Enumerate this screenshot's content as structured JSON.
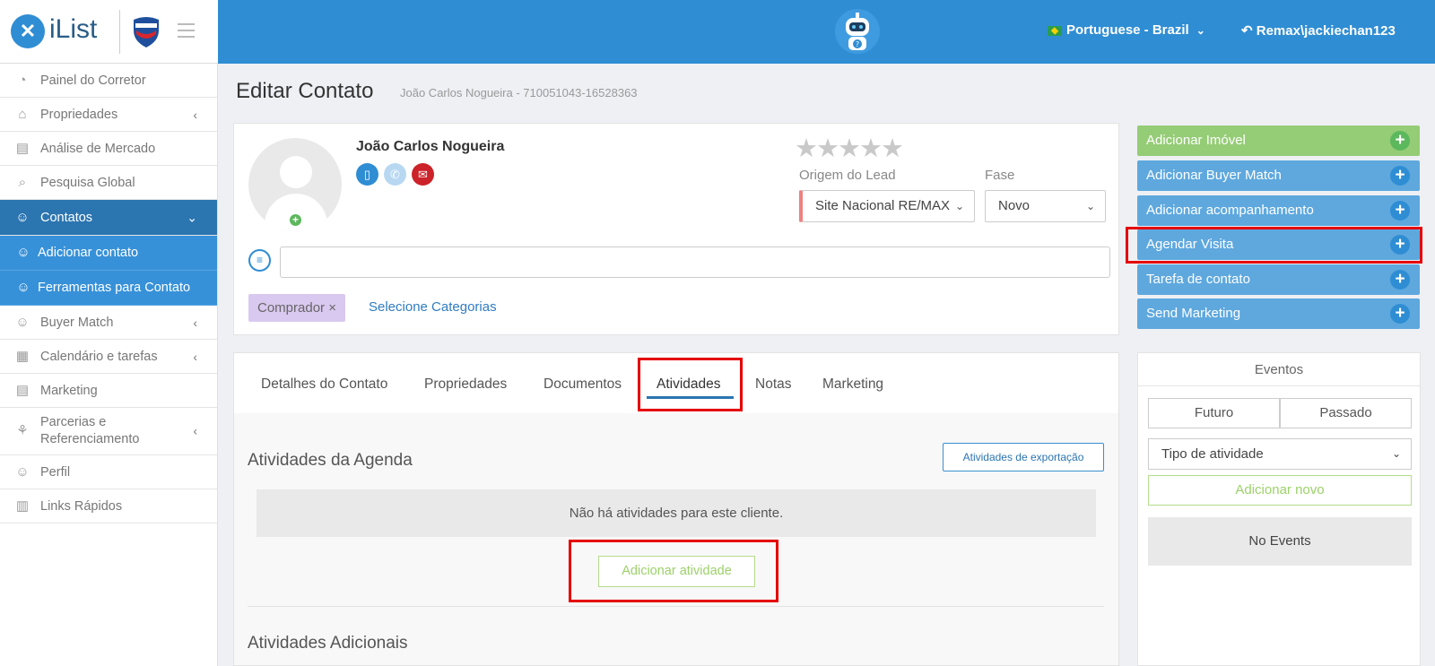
{
  "header": {
    "brand_name": "iList",
    "language": "Portuguese - Brazil",
    "user": "Remax\\jackiechan123"
  },
  "sidebar": {
    "items": [
      {
        "label": "Painel do Corretor",
        "icon": "gauge-icon"
      },
      {
        "label": "Propriedades",
        "icon": "home-icon"
      },
      {
        "label": "Análise de Mercado",
        "icon": "book-icon"
      },
      {
        "label": "Pesquisa Global",
        "icon": "search-icon"
      },
      {
        "label": "Contatos",
        "icon": "contacts-icon"
      },
      {
        "label": "Adicionar contato",
        "icon": "contacts-icon"
      },
      {
        "label": "Ferramentas para Contato",
        "icon": "contacts-icon"
      },
      {
        "label": "Buyer Match",
        "icon": "user-search-icon"
      },
      {
        "label": "Calendário e tarefas",
        "icon": "calendar-icon"
      },
      {
        "label": "Marketing",
        "icon": "book-icon"
      },
      {
        "label": "Parcerias e Referenciamento",
        "icon": "handshake-icon"
      },
      {
        "label": "Perfil",
        "icon": "user-icon"
      },
      {
        "label": "Links Rápidos",
        "icon": "store-icon"
      }
    ]
  },
  "page": {
    "title": "Editar Contato",
    "subtitle": "João Carlos Nogueira - 710051043-16528363"
  },
  "contact": {
    "name": "João Carlos Nogueira",
    "rating": 0,
    "lead_source_label": "Origem do Lead",
    "lead_source_value": "Site Nacional RE/MAX",
    "stage_label": "Fase",
    "stage_value": "Novo",
    "notes_value": "",
    "tag": "Comprador",
    "tag_remove": "×",
    "category_link": "Selecione Categorias"
  },
  "tabs": [
    {
      "label": "Detalhes do Contato"
    },
    {
      "label": "Propriedades"
    },
    {
      "label": "Documentos"
    },
    {
      "label": "Atividades",
      "active": true
    },
    {
      "label": "Notas"
    },
    {
      "label": "Marketing"
    }
  ],
  "activities": {
    "agenda_title": "Atividades da Agenda",
    "export_button": "Atividades de exportação",
    "empty_message": "Não há atividades para este cliente.",
    "add_button": "Adicionar atividade",
    "additional_title": "Atividades Adicionais"
  },
  "actions": [
    {
      "label": "Adicionar Imóvel",
      "color": "#95cc76"
    },
    {
      "label": "Adicionar Buyer Match",
      "color": "#5ea8de"
    },
    {
      "label": "Adicionar acompanhamento",
      "color": "#5ea8de"
    },
    {
      "label": "Agendar Visita",
      "color": "#5ea8de"
    },
    {
      "label": "Tarefa de contato",
      "color": "#5ea8de"
    },
    {
      "label": "Send Marketing",
      "color": "#5ea8de"
    }
  ],
  "events": {
    "title": "Eventos",
    "future": "Futuro",
    "past": "Passado",
    "type_select": "Tipo de atividade",
    "add_new": "Adicionar novo",
    "empty": "No Events"
  },
  "colors": {
    "primary": "#2f8dd3",
    "sidebar_active": "#2b75b0",
    "highlight": "#e50000",
    "success": "#5cb85c"
  }
}
